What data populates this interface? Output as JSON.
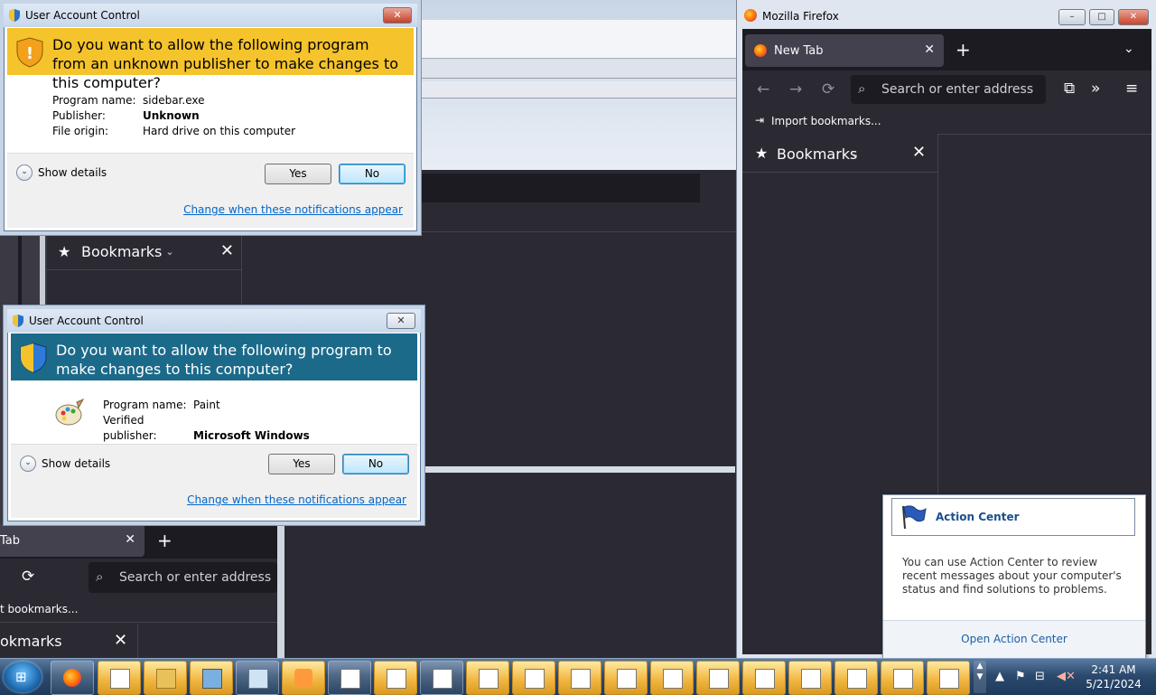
{
  "uac_top": {
    "title": "User Account Control",
    "question": "Do you want to allow the following program from an unknown publisher to make changes to this computer?",
    "program_label": "Program name:",
    "program_value": "sidebar.exe",
    "publisher_label": "Publisher:",
    "publisher_value": "Unknown",
    "origin_label": "File origin:",
    "origin_value": "Hard drive on this computer",
    "show_details": "Show details",
    "yes": "Yes",
    "no": "No",
    "link": "Change when these notifications appear",
    "close": "✕"
  },
  "uac_bottom": {
    "title": "User Account Control",
    "question": "Do you want to allow the following program to make changes to this computer?",
    "program_label": "Program name:",
    "program_value": "Paint",
    "publisher_label": "Verified publisher:",
    "publisher_value": "Microsoft Windows",
    "show_details": "Show details",
    "yes": "Yes",
    "no": "No",
    "link": "Change when these notifications appear",
    "close": "✕"
  },
  "firefox_right": {
    "window_title": "Mozilla Firefox",
    "tab_title": "New Tab",
    "tab_close": "✕",
    "new_tab": "+",
    "list_tabs": "⌄",
    "search_placeholder": "Search or enter address",
    "import_bookmarks": "Import bookmarks...",
    "sidebar_title": "Bookmarks",
    "sidebar_close": "✕",
    "minimize": "–",
    "maximize": "□",
    "close": "✕"
  },
  "firefox_bg_left": {
    "sidebar_title": "Bookmarks",
    "sidebar_close": "✕"
  },
  "firefox_bottom_left": {
    "tab_title": "Tab",
    "tab_close": "✕",
    "new_tab": "+",
    "search_placeholder": "Search or enter address",
    "import_bookmarks": "t bookmarks...",
    "sidebar_title": "okmarks",
    "sidebar_close": "✕"
  },
  "action_center": {
    "title": "Action Center",
    "body": "You can use Action Center to review recent messages about your computer's status and find solutions to problems.",
    "link": "Open Action Center"
  },
  "taskbar": {
    "time": "2:41 AM",
    "date": "5/21/2024"
  },
  "colors": {
    "uac_unknown_banner": "#f5c32c",
    "uac_verified_banner": "#1c6a8a",
    "firefox_dark": "#2b2a33",
    "link_blue": "#0066cc"
  }
}
